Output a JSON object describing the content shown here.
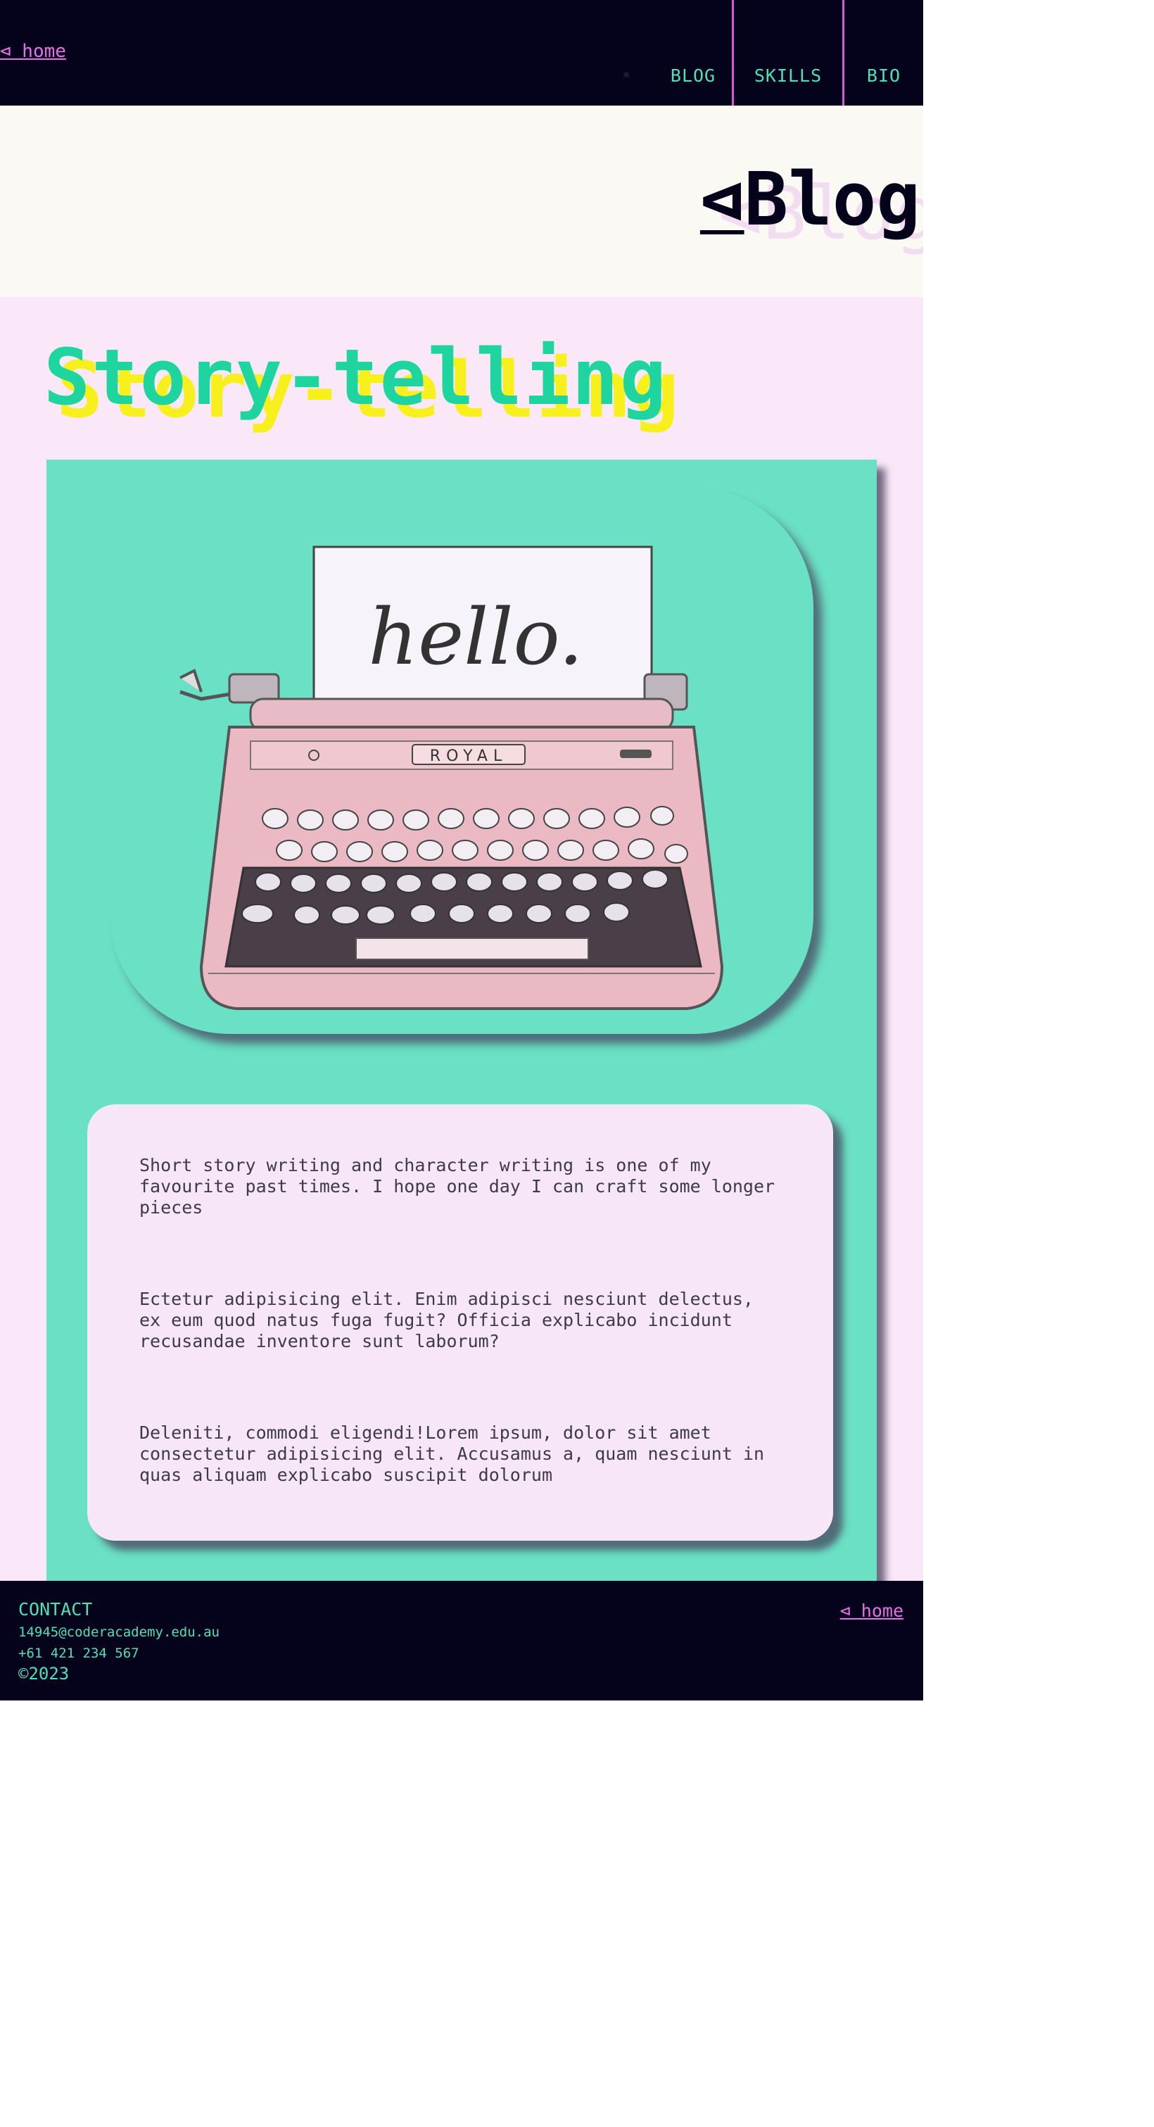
{
  "nav": {
    "home_label": "⊲ home",
    "links": [
      "BLOG",
      "SKILLS",
      "BIO"
    ]
  },
  "banner": {
    "title_icon": "⊲",
    "title": "Blog"
  },
  "article": {
    "title": "Story-telling",
    "image": {
      "description_icon": "typewriter-illustration",
      "paper_text": "hello.",
      "brand_text": "ROYAL"
    },
    "paragraphs": [
      "Short story writing and character writing is one of my favourite past times. I hope one day I can craft some longer pieces",
      "Ectetur adipisicing elit. Enim adipisci nesciunt delectus, ex eum quod natus fuga fugit? Officia explicabo incidunt recusandae inventore sunt laborum?",
      "Deleniti, commodi eligendi!Lorem ipsum, dolor sit amet consectetur adipisicing elit. Accusamus a, quam nesciunt in quas aliquam explicabo suscipit dolorum"
    ]
  },
  "footer": {
    "contact_label": "CONTACT",
    "email": "14945@coderacademy.edu.au",
    "phone": "+61 421 234 567",
    "copyright": "©2023",
    "home_label": "⊲ home"
  },
  "colors": {
    "nav_bg": "#05031c",
    "accent_green": "#4fe0b5",
    "accent_pink": "#e870e6",
    "card_teal": "#6ae0c4",
    "main_bg": "#fae8f9",
    "title_yellow": "#f7f01d"
  }
}
